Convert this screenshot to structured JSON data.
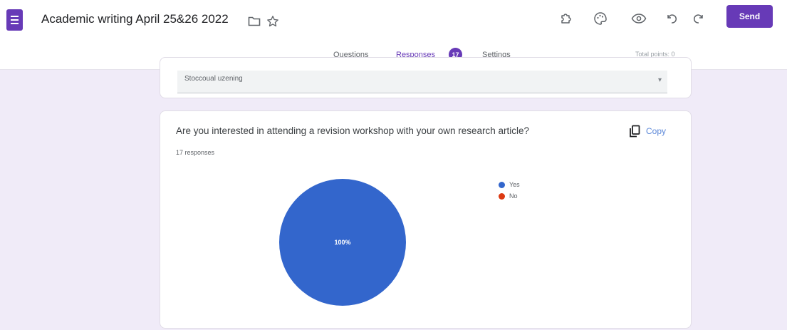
{
  "header": {
    "title": "Academic writing April 25&26 2022",
    "icons": [
      "forms-logo-icon",
      "folder-icon",
      "star-icon",
      "addon-puzzle-icon",
      "palette-icon",
      "preview-eye-icon",
      "undo-icon",
      "redo-icon"
    ],
    "send_label": "Send"
  },
  "tabs": {
    "questions": "Questions",
    "responses": "Responses",
    "response_badge": "17",
    "settings": "Settings",
    "total_points": "Total points: 0"
  },
  "previous_card": {
    "field_text": "Stoccoual uzening"
  },
  "question_card": {
    "question": "Are you interested in attending a revision workshop with your own research article?",
    "response_count": "17 responses",
    "copy_label": "Copy"
  },
  "colors": {
    "accent": "#673ab7",
    "yes": "#3366cc",
    "no": "#dc3912"
  },
  "chart_data": {
    "type": "pie",
    "categories": [
      "Yes",
      "No"
    ],
    "values": [
      100,
      0
    ],
    "slice_label": "100%",
    "colors": [
      "#3366cc",
      "#dc3912"
    ],
    "legend_position": "right"
  }
}
